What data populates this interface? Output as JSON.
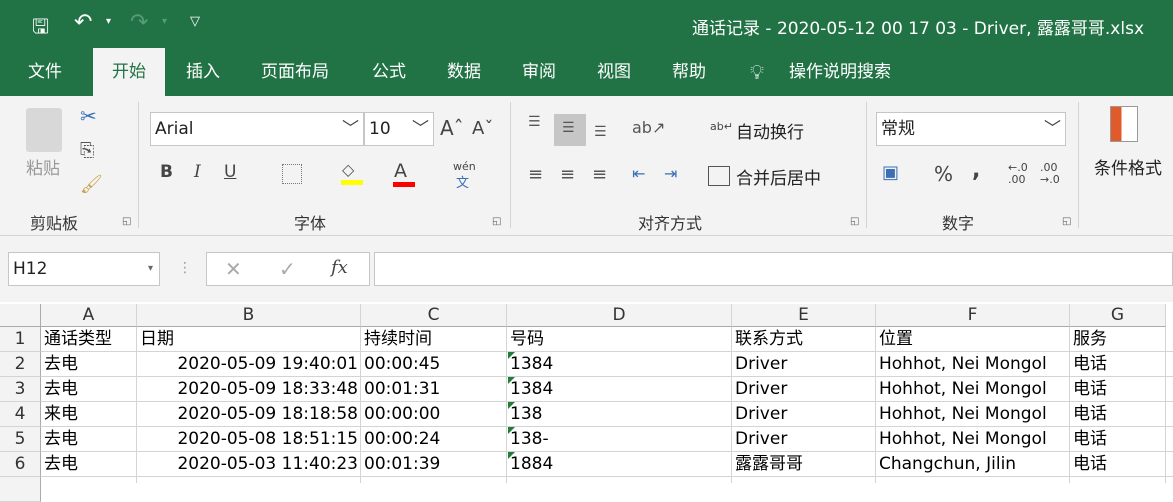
{
  "title": "通话记录 - 2020-05-12 00 17 03 - Driver, 露露哥哥.xlsx",
  "tabs": [
    "文件",
    "开始",
    "插入",
    "页面布局",
    "公式",
    "数据",
    "审阅",
    "视图",
    "帮助"
  ],
  "tell_me": "操作说明搜索",
  "ribbon": {
    "clipboard": {
      "paste": "粘贴",
      "label": "剪贴板"
    },
    "font": {
      "name": "Arial",
      "size": "10",
      "label": "字体",
      "bold": "B",
      "italic": "I",
      "underline": "U",
      "phonetic": "wén",
      "phonetic2": "文"
    },
    "alignment": {
      "wrap": "自动换行",
      "merge": "合并后居中",
      "label": "对齐方式"
    },
    "number": {
      "format": "常规",
      "percent": "%",
      "comma": ",",
      "label": "数字"
    },
    "styles": {
      "conditional": "条件格式"
    },
    "colors": {
      "fill": "#ffff00",
      "font": "#ff0000"
    }
  },
  "name_box": "H12",
  "formula": "",
  "columns": [
    "A",
    "B",
    "C",
    "D",
    "E",
    "F",
    "G"
  ],
  "rows": [
    [
      "通话类型",
      "日期",
      "持续时间",
      "号码",
      "联系方式",
      "位置",
      "服务"
    ],
    [
      "去电",
      "2020-05-09 19:40:01",
      "00:00:45",
      "1384",
      "Driver",
      "Hohhot, Nei Mongol",
      "电话"
    ],
    [
      "去电",
      "2020-05-09 18:33:48",
      "00:01:31",
      "1384",
      "Driver",
      "Hohhot, Nei Mongol",
      "电话"
    ],
    [
      "来电",
      "2020-05-09 18:18:58",
      "00:00:00",
      "138",
      "Driver",
      "Hohhot, Nei Mongol",
      "电话"
    ],
    [
      "去电",
      "2020-05-08 18:51:15",
      "00:00:24",
      "138-",
      "Driver",
      "Hohhot, Nei Mongol",
      "电话"
    ],
    [
      "去电",
      "2020-05-03 11:40:23",
      "00:01:39",
      "1884",
      "露露哥哥",
      "Changchun, Jilin",
      "电话"
    ]
  ],
  "row_numbers": [
    "1",
    "2",
    "3",
    "4",
    "5",
    "6"
  ]
}
